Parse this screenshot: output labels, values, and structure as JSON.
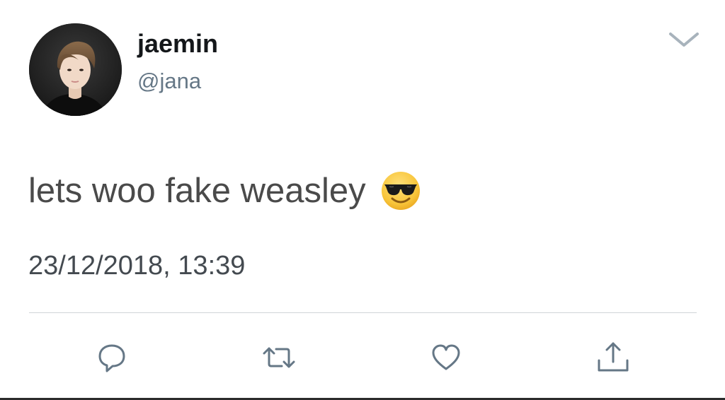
{
  "user": {
    "display_name": "jaemin",
    "handle": "@jana"
  },
  "tweet": {
    "text": "lets woo fake weasley",
    "emoji_icon": "smiling-face-with-sunglasses-icon",
    "timestamp": "23/12/2018, 13:39"
  },
  "actions": [
    {
      "name": "reply",
      "icon": "speech-bubble-icon"
    },
    {
      "name": "retweet",
      "icon": "retweet-arrows-icon"
    },
    {
      "name": "like",
      "icon": "heart-icon"
    },
    {
      "name": "share",
      "icon": "share-upload-icon"
    }
  ],
  "colors": {
    "action_icon": "#657786",
    "handle": "#657786",
    "divider": "#cfd4d8",
    "caret": "#a8b3bc"
  }
}
